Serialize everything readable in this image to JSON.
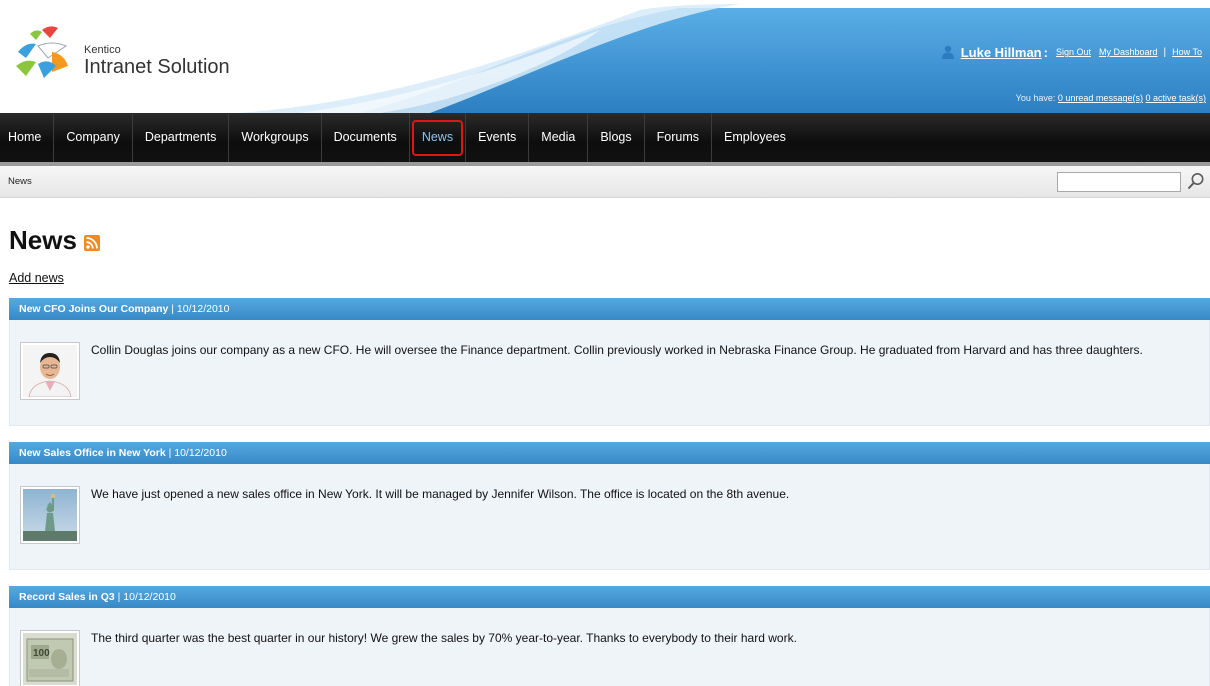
{
  "header": {
    "brand_small": "Kentico",
    "brand_title": "Intranet Solution",
    "user": {
      "name": "Luke Hillman",
      "separator": ":",
      "sign_out": "Sign Out",
      "dashboard": "My Dashboard",
      "pipe": "|",
      "how_to": "How To"
    },
    "messages": {
      "prefix": "You have:",
      "unread": "0 unread message(s)",
      "tasks": "0 active task(s)"
    }
  },
  "nav": {
    "items": [
      "Home",
      "Company",
      "Departments",
      "Workgroups",
      "Documents",
      "News",
      "Events",
      "Media",
      "Blogs",
      "Forums",
      "Employees"
    ],
    "active": "News"
  },
  "breadcrumb": "News",
  "search": {
    "value": "",
    "placeholder": ""
  },
  "page": {
    "title": "News",
    "add_link": "Add news"
  },
  "news": [
    {
      "title": "New CFO Joins Our Company",
      "date": "| 10/12/2010",
      "text": "Collin Douglas joins our company as a new CFO. He will oversee the Finance department. Collin previously worked in Nebraska Finance Group. He graduated from Harvard and has three daughters."
    },
    {
      "title": "New Sales Office in New York",
      "date": "| 10/12/2010",
      "text": "We have just opened a new sales office in New York. It will be managed by Jennifer Wilson. The office is located on the 8th avenue."
    },
    {
      "title": "Record Sales in Q3",
      "date": "| 10/12/2010",
      "text": "The third quarter was the best quarter in our history! We grew the sales by 70% year-to-year. Thanks to everybody to their hard work."
    }
  ],
  "colors": {
    "nav_active_text": "#8fc5ee",
    "highlight": "#e01515",
    "news_header": "#3d8fcc"
  },
  "icons": [
    "user-icon",
    "search-icon",
    "rss-icon"
  ]
}
